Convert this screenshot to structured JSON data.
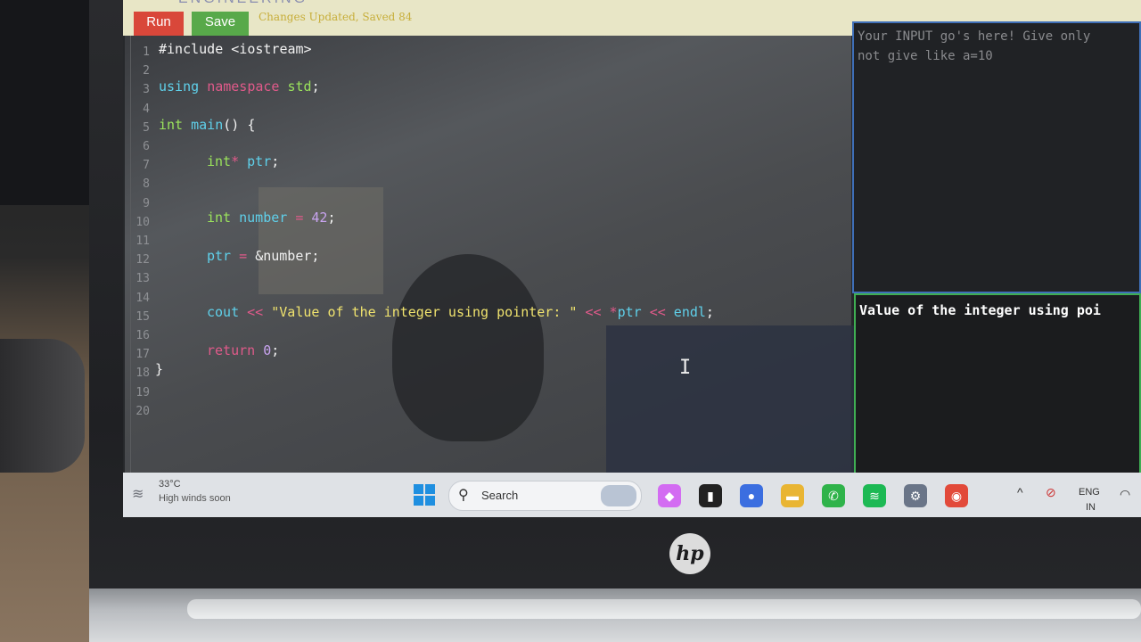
{
  "brand": "ENGINEERING",
  "toolbar": {
    "run_label": "Run",
    "save_label": "Save",
    "status": "Changes Updated, Saved 84"
  },
  "editor": {
    "line_numbers": [
      "1",
      "2",
      "3",
      "4",
      "5",
      "6",
      "7",
      "8",
      "9",
      "10",
      "11",
      "12",
      "13",
      "14",
      "15",
      "16",
      "17",
      "18",
      "19",
      "20"
    ]
  },
  "input_panel": {
    "placeholder": "Your INPUT go's here! Give only\nnot give like a=10"
  },
  "output_panel": {
    "text": "Value of the integer using poi"
  },
  "taskbar": {
    "weather_temp": "33°C",
    "weather_desc": "High winds soon",
    "search_label": "Search",
    "lang_top": "ENG",
    "lang_bottom": "IN",
    "pinned_apps": [
      {
        "name": "copilot-icon",
        "glyph": "◆",
        "color": "#d36cf2"
      },
      {
        "name": "terminal-icon",
        "glyph": "▮",
        "color": "#222222"
      },
      {
        "name": "meet-icon",
        "glyph": "●",
        "color": "#3b6ee0"
      },
      {
        "name": "folder-icon",
        "glyph": "▬",
        "color": "#e9b533"
      },
      {
        "name": "whatsapp-icon",
        "glyph": "✆",
        "color": "#2fb34a"
      },
      {
        "name": "spotify-icon",
        "glyph": "≋",
        "color": "#1db954"
      },
      {
        "name": "settings-icon",
        "glyph": "⚙",
        "color": "#6a7588"
      },
      {
        "name": "chrome-icon",
        "glyph": "◉",
        "color": "#e24a3a"
      }
    ]
  },
  "hardware": {
    "logo": "hp"
  }
}
